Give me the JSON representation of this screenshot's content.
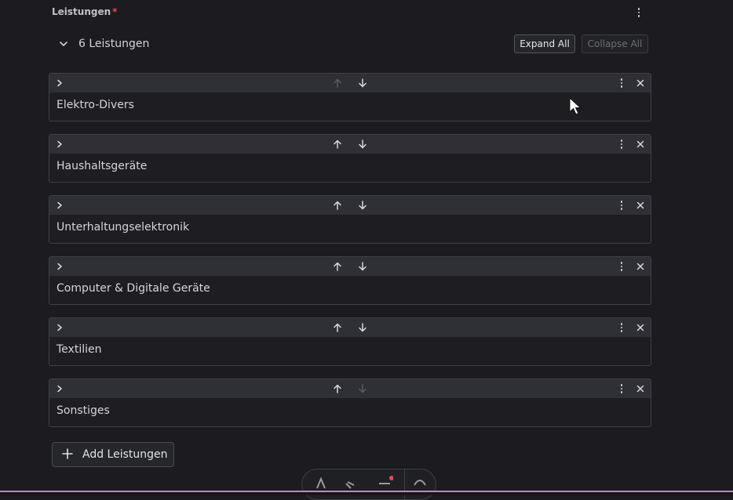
{
  "field": {
    "label": "Leistungen",
    "required_marker": "*"
  },
  "summary": {
    "count_label": "6 Leistungen"
  },
  "actions": {
    "expand_all": "Expand All",
    "collapse_all": "Collapse All",
    "add_label": "Add Leistungen"
  },
  "items": [
    {
      "title": "Elektro-Divers",
      "up_enabled": false,
      "down_enabled": true
    },
    {
      "title": "Haushaltsgeräte",
      "up_enabled": true,
      "down_enabled": true
    },
    {
      "title": "Unterhaltungselektronik",
      "up_enabled": true,
      "down_enabled": true
    },
    {
      "title": "Computer & Digitale Geräte",
      "up_enabled": true,
      "down_enabled": true
    },
    {
      "title": "Textilien",
      "up_enabled": true,
      "down_enabled": true
    },
    {
      "title": "Sonstiges",
      "up_enabled": true,
      "down_enabled": false
    }
  ],
  "icons": {
    "expand": "chevron-right-icon",
    "up": "arrow-up-icon",
    "down": "arrow-down-icon",
    "menu": "more-vertical-icon",
    "remove": "close-icon",
    "add": "plus-icon",
    "collapse_group": "chevron-down-icon"
  },
  "colors": {
    "background": "#1c1c20",
    "item_header": "#2e3036",
    "required": "#e5484d",
    "icon_active": "#d9d9dd",
    "icon_disabled": "#5a5b60",
    "bottom_accent": "#b98fb6"
  }
}
